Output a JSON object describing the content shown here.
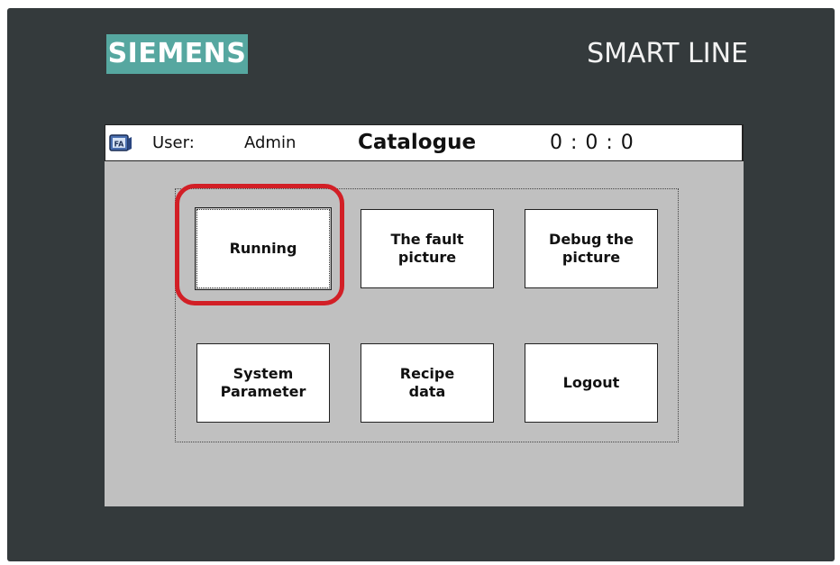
{
  "device": {
    "brand": "SIEMENS",
    "model": "SMART LINE",
    "bezel_color": "#343a3c",
    "brand_color": "#56a7a0"
  },
  "titlebar": {
    "icon": "fa-icon",
    "user_label": "User:",
    "user_value": "Admin",
    "title": "Catalogue",
    "clock": "0 : 0 : 0"
  },
  "buttons": {
    "running": "Running",
    "fault_picture": "The fault\npicture",
    "debug_picture": "Debug the\npicture",
    "system_parameter": "System\nParameter",
    "recipe_data": "Recipe\ndata",
    "logout": "Logout"
  },
  "annotation": {
    "highlight_color": "#d21f26",
    "highlighted_button": "Running"
  }
}
